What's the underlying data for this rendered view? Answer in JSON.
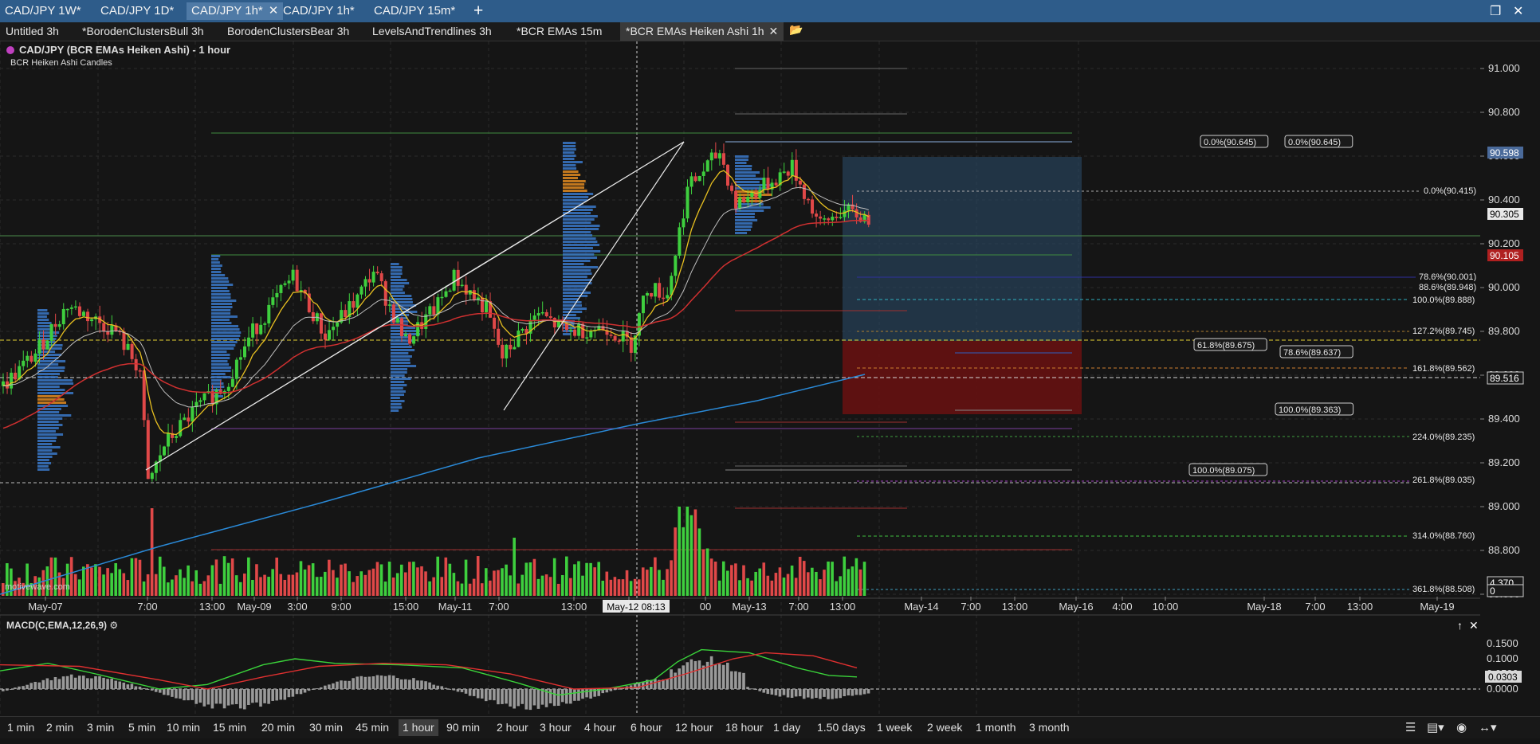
{
  "window_tabs": [
    {
      "label": "CAD/JPY 1W*",
      "active": false,
      "close": false
    },
    {
      "label": "CAD/JPY 1D*",
      "active": false,
      "close": false
    },
    {
      "label": "CAD/JPY 1h*",
      "active": true,
      "close": true
    },
    {
      "label": "CAD/JPY 1h*",
      "active": false,
      "close": false
    },
    {
      "label": "CAD/JPY 15m*",
      "active": false,
      "close": false
    }
  ],
  "window_controls": {
    "add": "+",
    "restore": "❐",
    "close": "✕"
  },
  "workspace_tabs": [
    {
      "label": "Untitled 3h",
      "active": false
    },
    {
      "label": "*BorodenClustersBull 3h",
      "active": false
    },
    {
      "label": "BorodenClustersBear 3h",
      "active": false
    },
    {
      "label": "LevelsAndTrendlines 3h",
      "active": false
    },
    {
      "label": "*BCR EMAs 15m",
      "active": false
    },
    {
      "label": "*BCR EMAs Heiken Ashi 1h",
      "active": true
    }
  ],
  "chart": {
    "title": "CAD/JPY (BCR EMAs Heiken Ashi) - 1 hour",
    "subtitle": "BCR Heiken Ashi Candles",
    "watermark": "motivewave.com",
    "crosshair_date": "May-12 08:13",
    "colors": {
      "up": "#3ecf3e",
      "down": "#e04848",
      "volume_profile": "#3a78c8",
      "fast_ema": "#e8c020",
      "mid_ema": "#bdbdbd",
      "slow_ema": "#d03030",
      "long_ema": "#2a8ad8",
      "target_zone": "#2a4a66",
      "stop_zone": "#6a1010"
    }
  },
  "price_axis": {
    "ticks": [
      "91.000",
      "90.800",
      "90.600",
      "90.400",
      "90.200",
      "90.000",
      "89.800",
      "89.600",
      "89.400",
      "89.200",
      "89.000",
      "88.800",
      "88.600"
    ],
    "badges": [
      {
        "label": "90.598",
        "color": "#4a6a9a"
      },
      {
        "label": "90.305",
        "color": "#e8e8e8"
      },
      {
        "label": "90.105",
        "color": "#b02020"
      },
      {
        "label": "89.516",
        "color": "#1a1a1a"
      },
      {
        "label": "4.370",
        "color": "#1a1a1a"
      },
      {
        "label": "0",
        "color": "#1a1a1a"
      }
    ]
  },
  "time_axis": [
    "May-07",
    "7:00",
    "13:00",
    "May-09",
    "3:00",
    "9:00",
    "15:00",
    "May-11",
    "7:00",
    "13:00",
    "May-12",
    "00",
    "May-13",
    "7:00",
    "13:00",
    "May-14",
    "7:00",
    "13:00",
    "May-16",
    "4:00",
    "10:00",
    "May-18",
    "7:00",
    "13:00",
    "May-19"
  ],
  "fib_labels": [
    "0.0%(90.645)",
    "0.0%(90.645)",
    "0.0%(90.415)",
    "78.6%(90.001)",
    "88.6%(89.948)",
    "100.0%(89.888)",
    "127.2%(89.745)",
    "61.8%(89.675)",
    "78.6%(89.637)",
    "161.8%(89.562)",
    "100.0%(89.363)",
    "224.0%(89.235)",
    "100.0%(89.075)",
    "261.8%(89.035)",
    "314.0%(88.760)",
    "361.8%(88.508)"
  ],
  "macd": {
    "title": "MACD(C,EMA,12,26,9)",
    "ticks": [
      "0.1500",
      "0.1000",
      "0.0500",
      "0.0000"
    ],
    "badge": "0.0303",
    "controls": [
      "↑",
      "✕"
    ]
  },
  "timeframes": [
    {
      "label": "1 min",
      "active": false
    },
    {
      "label": "2 min",
      "active": false
    },
    {
      "label": "3 min",
      "active": false
    },
    {
      "label": "5 min",
      "active": false
    },
    {
      "label": "10 min",
      "active": false
    },
    {
      "label": "15 min",
      "active": false
    },
    {
      "label": "20 min",
      "active": false
    },
    {
      "label": "30 min",
      "active": false
    },
    {
      "label": "45 min",
      "active": false
    },
    {
      "label": "1 hour",
      "active": true
    },
    {
      "label": "90 min",
      "active": false
    },
    {
      "label": "2 hour",
      "active": false
    },
    {
      "label": "3 hour",
      "active": false
    },
    {
      "label": "4 hour",
      "active": false
    },
    {
      "label": "6 hour",
      "active": false
    },
    {
      "label": "12 hour",
      "active": false
    },
    {
      "label": "18 hour",
      "active": false
    },
    {
      "label": "1 day",
      "active": false
    },
    {
      "label": "1.50 days",
      "active": false
    },
    {
      "label": "1 week",
      "active": false
    },
    {
      "label": "2 week",
      "active": false
    },
    {
      "label": "1 month",
      "active": false
    },
    {
      "label": "3 month",
      "active": false
    }
  ],
  "toolbar_icons": [
    {
      "name": "list-icon",
      "glyph": "☰"
    },
    {
      "name": "chart-type-icon",
      "glyph": "▤▾"
    },
    {
      "name": "eye-icon",
      "glyph": "◉"
    },
    {
      "name": "range-icon",
      "glyph": "↔▾"
    }
  ]
}
